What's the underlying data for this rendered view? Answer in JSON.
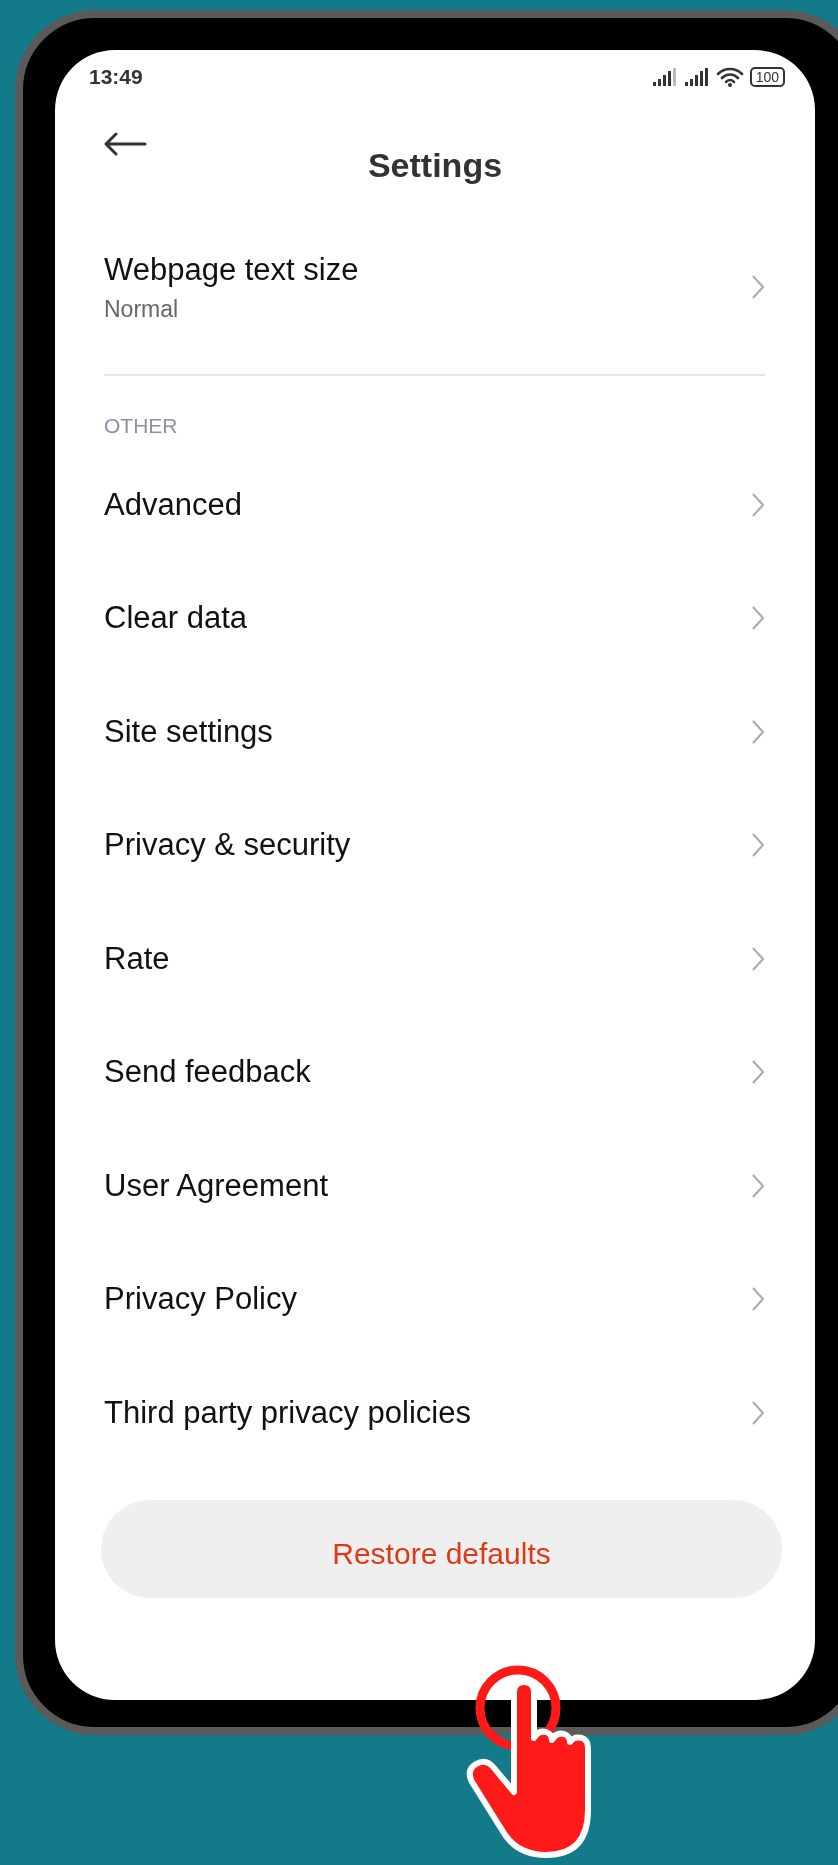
{
  "status_bar": {
    "time": "13:49",
    "battery": "100"
  },
  "header": {
    "title": "Settings"
  },
  "top_item": {
    "label": "Webpage text size",
    "value": "Normal"
  },
  "section": {
    "title": "OTHER"
  },
  "items": [
    {
      "label": "Advanced"
    },
    {
      "label": "Clear data"
    },
    {
      "label": "Site settings"
    },
    {
      "label": "Privacy & security"
    },
    {
      "label": "Rate"
    },
    {
      "label": "Send feedback"
    },
    {
      "label": "User Agreement"
    },
    {
      "label": "Privacy Policy"
    },
    {
      "label": "Third party privacy policies"
    }
  ],
  "button": {
    "label": "Restore defaults"
  }
}
